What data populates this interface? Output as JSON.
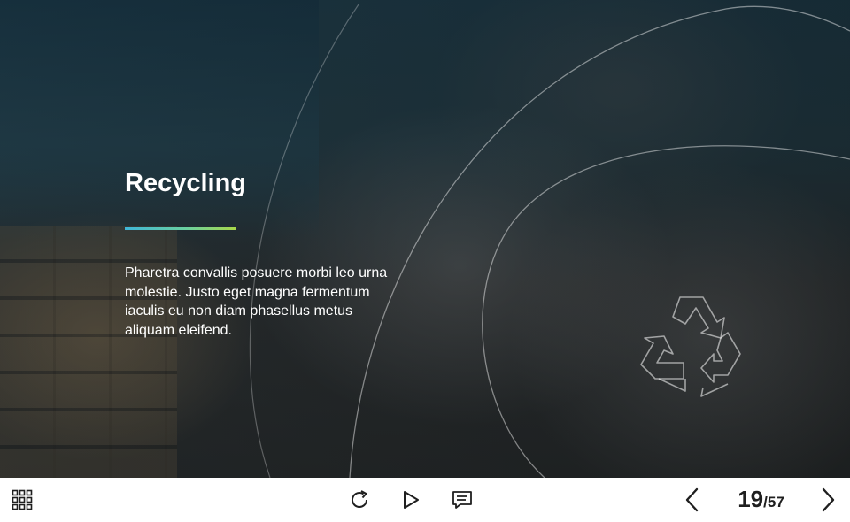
{
  "slide": {
    "title": "Recycling",
    "body": "Pharetra convallis posuere morbi leo urna molestie. Justo eget magna fermentum iaculis eu non diam phasellus metus aliquam eleifend.",
    "background_image": "paper-waste-bales-photo",
    "accent_gradient": [
      "#3fb6d8",
      "#6ad0a0",
      "#a8d84a"
    ]
  },
  "player": {
    "menu_icon": "grid-menu-icon",
    "replay_icon": "replay-icon",
    "play_icon": "play-icon",
    "notes_icon": "notes-icon",
    "prev_icon": "chevron-left-icon",
    "next_icon": "chevron-right-icon",
    "current_slide": "19",
    "separator": "/",
    "total_slides": "57",
    "icon_color": "#1f1f1f"
  }
}
